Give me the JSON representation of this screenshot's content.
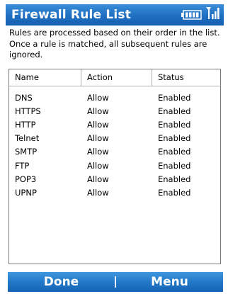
{
  "title_bar": {
    "title": "Firewall Rule List",
    "battery_icon": "battery-icon",
    "signal_icon": "signal-icon"
  },
  "description": "Rules are processed based on their order in the list. Once a rule is matched, all subsequent rules are ignored.",
  "list": {
    "columns": [
      "Name",
      "Action",
      "Status"
    ],
    "rows": [
      {
        "name": "DNS",
        "action": "Allow",
        "status": "Enabled"
      },
      {
        "name": "HTTPS",
        "action": "Allow",
        "status": "Enabled"
      },
      {
        "name": "HTTP",
        "action": "Allow",
        "status": "Enabled"
      },
      {
        "name": "Telnet",
        "action": "Allow",
        "status": "Enabled"
      },
      {
        "name": "SMTP",
        "action": "Allow",
        "status": "Enabled"
      },
      {
        "name": "FTP",
        "action": "Allow",
        "status": "Enabled"
      },
      {
        "name": "POP3",
        "action": "Allow",
        "status": "Enabled"
      },
      {
        "name": "UPNP",
        "action": "Allow",
        "status": "Enabled"
      }
    ]
  },
  "softkeys": {
    "left": "Done",
    "right": "Menu"
  },
  "colors": {
    "title_bar": "#1f6fc2",
    "softkey_bar": "#2278c8"
  }
}
